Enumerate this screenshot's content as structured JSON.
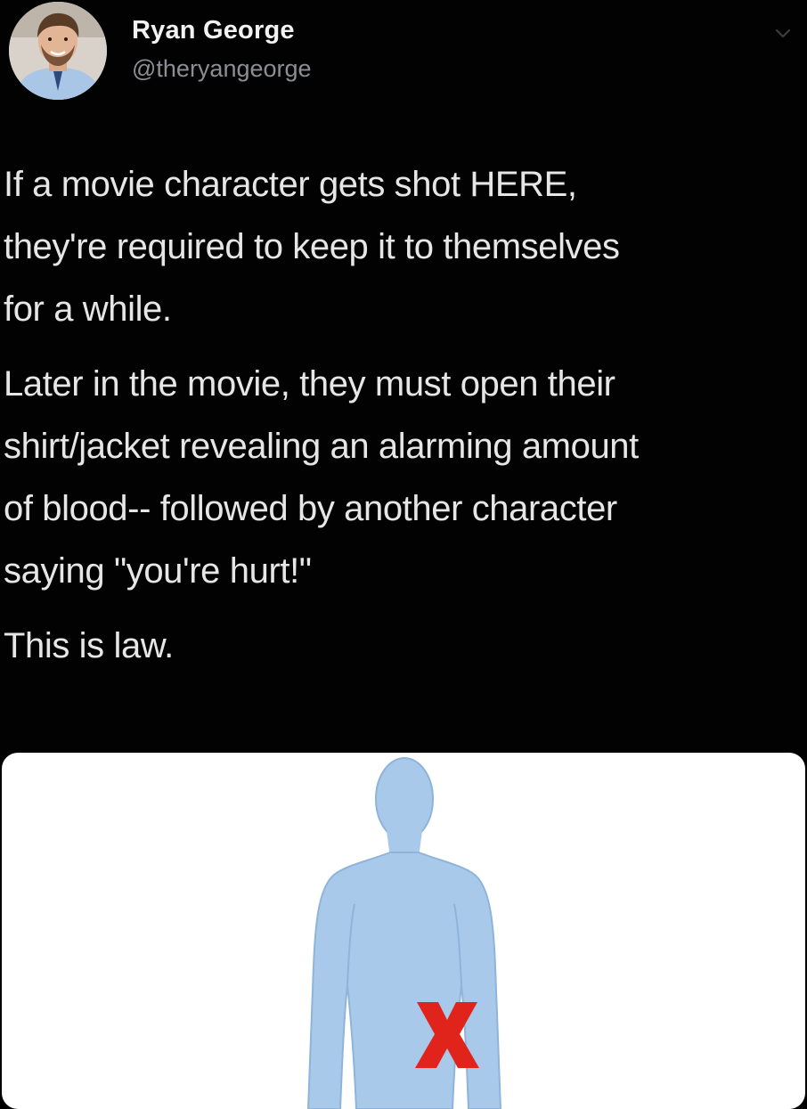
{
  "tweet": {
    "author": {
      "name": "Ryan George",
      "handle": "@theryangeorge",
      "avatar_icon": "profile-photo"
    },
    "menu_icon": "chevron-down-icon",
    "paragraphs": [
      "If a movie character gets shot HERE,\nthey're required to keep it to themselves\nfor a while.",
      "Later in the movie, they must open their\nshirt/jacket revealing an alarming amount\nof blood-- followed by another character\nsaying \"you're hurt!\"",
      "This is law."
    ],
    "media": {
      "description_icon": "human-body-diagram",
      "marker": "X",
      "colors": {
        "body": "#a9c9ea",
        "body_outline": "#8fb4d9",
        "marker": "#e0241b",
        "background": "#ffffff"
      }
    }
  },
  "colors": {
    "background": "#000000",
    "text": "#e6e6e6",
    "handle": "#8b8f94"
  }
}
